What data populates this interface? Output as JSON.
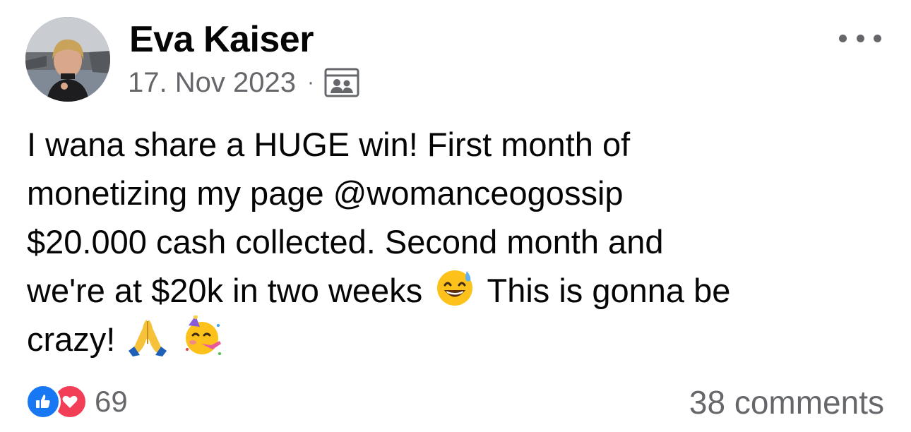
{
  "post": {
    "author": "Eva Kaiser",
    "date": "17. Nov 2023",
    "separator": "·",
    "audience_icon": "friends-group-icon",
    "more_icon": "more-horizontal-icon",
    "text_lines": [
      "I wana share a HUGE win! First month of",
      "monetizing my page @womanceogossip",
      "$20.000 cash collected. Second month and",
      "we're at $20k in two weeks",
      "This is gonna be",
      "crazy!"
    ],
    "emojis": [
      "grinning-sweat-emoji",
      "folded-hands-emoji",
      "partying-face-emoji"
    ]
  },
  "footer": {
    "reaction_icons": [
      "like-icon",
      "love-icon"
    ],
    "reaction_count": "69",
    "comments_label": "38 comments"
  },
  "colors": {
    "text_primary": "#050505",
    "text_secondary": "#65676b",
    "like_blue": "#1877f2",
    "love_red": "#f33e58"
  }
}
